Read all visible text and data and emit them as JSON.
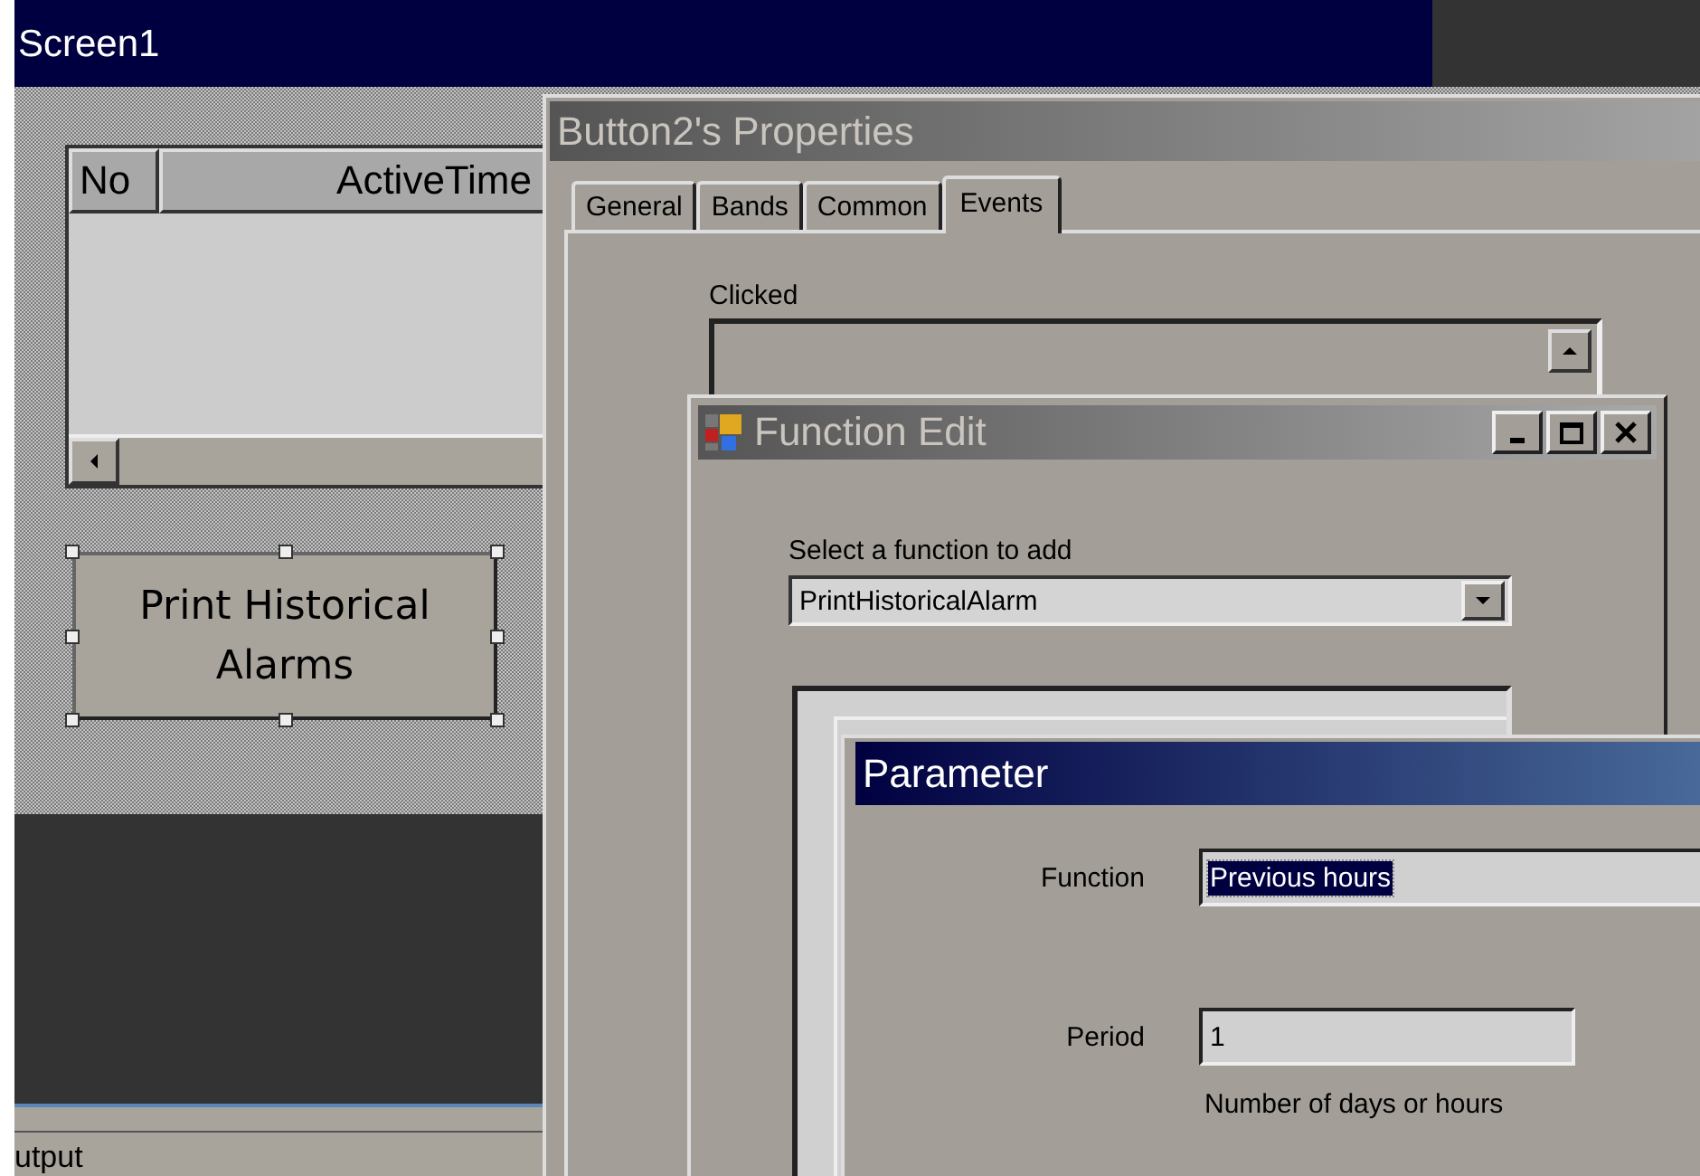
{
  "screen": {
    "title": "Screen1"
  },
  "alarm_table": {
    "columns": [
      "No",
      "ActiveTime"
    ]
  },
  "designer_button": {
    "label": "Print Historical Alarms",
    "selected": true
  },
  "output_panel": {
    "title": "utput"
  },
  "properties_window": {
    "title": "Button2's Properties",
    "tabs": [
      {
        "label": "General",
        "selected": false
      },
      {
        "label": "Bands",
        "selected": false
      },
      {
        "label": "Common",
        "selected": false
      },
      {
        "label": "Events",
        "selected": true
      }
    ],
    "event_label": "Clicked"
  },
  "function_edit": {
    "title": "Function Edit",
    "select_label": "Select a function to add",
    "function_value": "PrintHistoricalAlarm"
  },
  "parameter": {
    "title": "Parameter",
    "fields": [
      {
        "label": "Function",
        "value": "Previous hours",
        "selected": true
      },
      {
        "label": "Period",
        "value": "1",
        "selected": false,
        "hint": "Number of days or hours"
      }
    ]
  }
}
